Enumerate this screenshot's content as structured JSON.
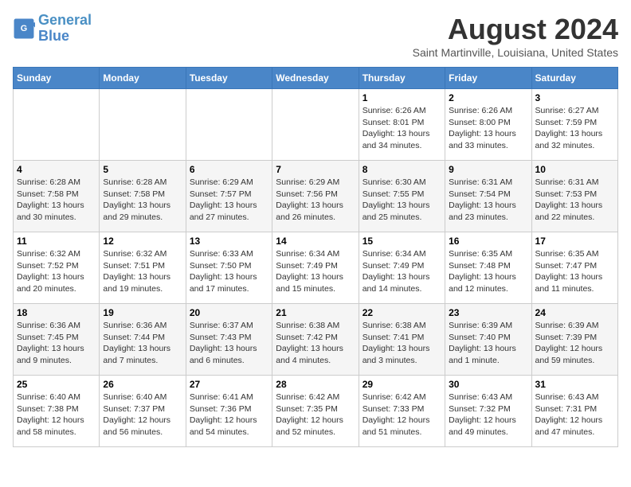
{
  "logo": {
    "line1": "General",
    "line2": "Blue"
  },
  "title": "August 2024",
  "location": "Saint Martinville, Louisiana, United States",
  "days_of_week": [
    "Sunday",
    "Monday",
    "Tuesday",
    "Wednesday",
    "Thursday",
    "Friday",
    "Saturday"
  ],
  "weeks": [
    [
      {
        "day": "",
        "info": ""
      },
      {
        "day": "",
        "info": ""
      },
      {
        "day": "",
        "info": ""
      },
      {
        "day": "",
        "info": ""
      },
      {
        "day": "1",
        "info": "Sunrise: 6:26 AM\nSunset: 8:01 PM\nDaylight: 13 hours\nand 34 minutes."
      },
      {
        "day": "2",
        "info": "Sunrise: 6:26 AM\nSunset: 8:00 PM\nDaylight: 13 hours\nand 33 minutes."
      },
      {
        "day": "3",
        "info": "Sunrise: 6:27 AM\nSunset: 7:59 PM\nDaylight: 13 hours\nand 32 minutes."
      }
    ],
    [
      {
        "day": "4",
        "info": "Sunrise: 6:28 AM\nSunset: 7:58 PM\nDaylight: 13 hours\nand 30 minutes."
      },
      {
        "day": "5",
        "info": "Sunrise: 6:28 AM\nSunset: 7:58 PM\nDaylight: 13 hours\nand 29 minutes."
      },
      {
        "day": "6",
        "info": "Sunrise: 6:29 AM\nSunset: 7:57 PM\nDaylight: 13 hours\nand 27 minutes."
      },
      {
        "day": "7",
        "info": "Sunrise: 6:29 AM\nSunset: 7:56 PM\nDaylight: 13 hours\nand 26 minutes."
      },
      {
        "day": "8",
        "info": "Sunrise: 6:30 AM\nSunset: 7:55 PM\nDaylight: 13 hours\nand 25 minutes."
      },
      {
        "day": "9",
        "info": "Sunrise: 6:31 AM\nSunset: 7:54 PM\nDaylight: 13 hours\nand 23 minutes."
      },
      {
        "day": "10",
        "info": "Sunrise: 6:31 AM\nSunset: 7:53 PM\nDaylight: 13 hours\nand 22 minutes."
      }
    ],
    [
      {
        "day": "11",
        "info": "Sunrise: 6:32 AM\nSunset: 7:52 PM\nDaylight: 13 hours\nand 20 minutes."
      },
      {
        "day": "12",
        "info": "Sunrise: 6:32 AM\nSunset: 7:51 PM\nDaylight: 13 hours\nand 19 minutes."
      },
      {
        "day": "13",
        "info": "Sunrise: 6:33 AM\nSunset: 7:50 PM\nDaylight: 13 hours\nand 17 minutes."
      },
      {
        "day": "14",
        "info": "Sunrise: 6:34 AM\nSunset: 7:49 PM\nDaylight: 13 hours\nand 15 minutes."
      },
      {
        "day": "15",
        "info": "Sunrise: 6:34 AM\nSunset: 7:49 PM\nDaylight: 13 hours\nand 14 minutes."
      },
      {
        "day": "16",
        "info": "Sunrise: 6:35 AM\nSunset: 7:48 PM\nDaylight: 13 hours\nand 12 minutes."
      },
      {
        "day": "17",
        "info": "Sunrise: 6:35 AM\nSunset: 7:47 PM\nDaylight: 13 hours\nand 11 minutes."
      }
    ],
    [
      {
        "day": "18",
        "info": "Sunrise: 6:36 AM\nSunset: 7:45 PM\nDaylight: 13 hours\nand 9 minutes."
      },
      {
        "day": "19",
        "info": "Sunrise: 6:36 AM\nSunset: 7:44 PM\nDaylight: 13 hours\nand 7 minutes."
      },
      {
        "day": "20",
        "info": "Sunrise: 6:37 AM\nSunset: 7:43 PM\nDaylight: 13 hours\nand 6 minutes."
      },
      {
        "day": "21",
        "info": "Sunrise: 6:38 AM\nSunset: 7:42 PM\nDaylight: 13 hours\nand 4 minutes."
      },
      {
        "day": "22",
        "info": "Sunrise: 6:38 AM\nSunset: 7:41 PM\nDaylight: 13 hours\nand 3 minutes."
      },
      {
        "day": "23",
        "info": "Sunrise: 6:39 AM\nSunset: 7:40 PM\nDaylight: 13 hours\nand 1 minute."
      },
      {
        "day": "24",
        "info": "Sunrise: 6:39 AM\nSunset: 7:39 PM\nDaylight: 12 hours\nand 59 minutes."
      }
    ],
    [
      {
        "day": "25",
        "info": "Sunrise: 6:40 AM\nSunset: 7:38 PM\nDaylight: 12 hours\nand 58 minutes."
      },
      {
        "day": "26",
        "info": "Sunrise: 6:40 AM\nSunset: 7:37 PM\nDaylight: 12 hours\nand 56 minutes."
      },
      {
        "day": "27",
        "info": "Sunrise: 6:41 AM\nSunset: 7:36 PM\nDaylight: 12 hours\nand 54 minutes."
      },
      {
        "day": "28",
        "info": "Sunrise: 6:42 AM\nSunset: 7:35 PM\nDaylight: 12 hours\nand 52 minutes."
      },
      {
        "day": "29",
        "info": "Sunrise: 6:42 AM\nSunset: 7:33 PM\nDaylight: 12 hours\nand 51 minutes."
      },
      {
        "day": "30",
        "info": "Sunrise: 6:43 AM\nSunset: 7:32 PM\nDaylight: 12 hours\nand 49 minutes."
      },
      {
        "day": "31",
        "info": "Sunrise: 6:43 AM\nSunset: 7:31 PM\nDaylight: 12 hours\nand 47 minutes."
      }
    ]
  ]
}
